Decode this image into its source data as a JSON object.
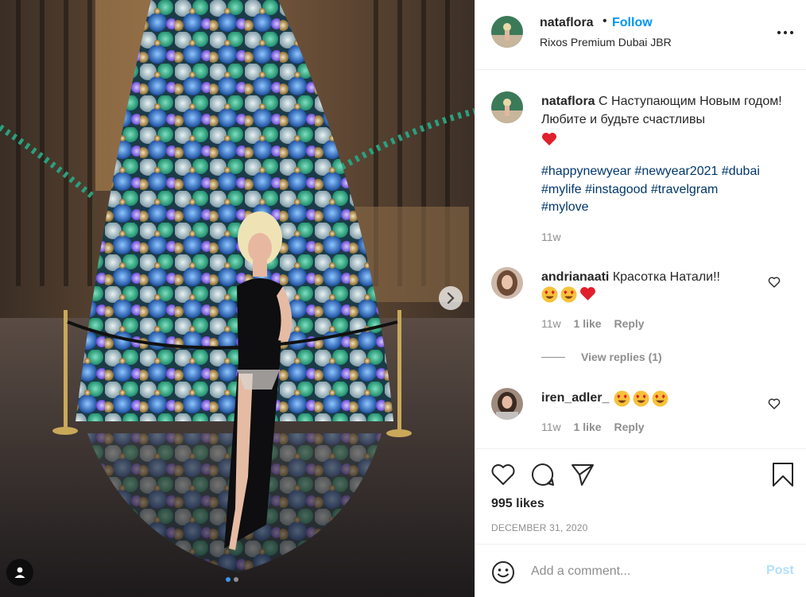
{
  "post": {
    "photo_alt": "",
    "carousel_dots": 2,
    "carousel_active": 0
  },
  "header": {
    "username": "nataflora",
    "separator": "•",
    "follow_label": "Follow",
    "location": "Rixos Premium Dubai JBR"
  },
  "caption": {
    "username": "nataflora",
    "text": "С Наступающим Новым годом! Любите и будьте счастливы",
    "emoji": "red-heart-emoji",
    "hashtags": [
      "#happynewyear",
      "#newyear2021",
      "#dubai",
      "#mylife",
      "#instagood",
      "#travelgram",
      "#mylove"
    ],
    "age": "11w"
  },
  "comments": [
    {
      "username": "andrianaati",
      "text": "Красотка Натали!!",
      "emojis": [
        "smiling-face-with-heart-eyes-emoji",
        "smiling-face-with-heart-eyes-emoji",
        "red-heart-emoji"
      ],
      "age": "11w",
      "likes": "1 like",
      "reply_label": "Reply",
      "view_replies": "View replies (1)"
    },
    {
      "username": "iren_adler_",
      "text": "",
      "emojis": [
        "smiling-face-with-heart-eyes-emoji",
        "smiling-face-with-heart-eyes-emoji",
        "smiling-face-with-heart-eyes-emoji"
      ],
      "age": "11w",
      "likes": "1 like",
      "reply_label": "Reply"
    }
  ],
  "actions": {
    "likes": "995 likes",
    "date": "DECEMBER 31, 2020"
  },
  "add_comment": {
    "placeholder": "Add a comment...",
    "post_label": "Post"
  },
  "colors": {
    "accent": "#0095f6",
    "hashtag": "#00376b",
    "muted": "#8e8e8e",
    "post_disabled": "#b2dffc",
    "heart": "#ed4956"
  }
}
